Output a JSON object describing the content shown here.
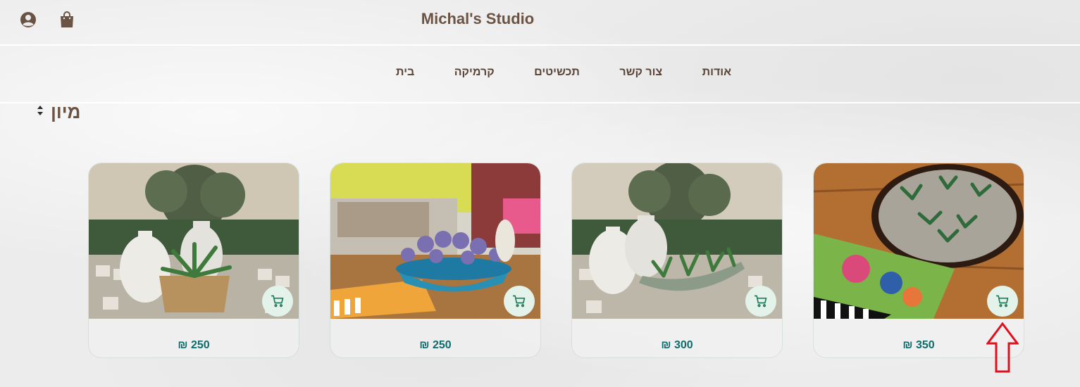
{
  "header": {
    "brand": "Michal's Studio",
    "icons": [
      "account-icon",
      "shopping-bag-icon"
    ]
  },
  "nav": {
    "items": [
      {
        "label": "בית"
      },
      {
        "label": "קרמיקה"
      },
      {
        "label": "תכשיטים"
      },
      {
        "label": "צור קשר"
      },
      {
        "label": "אודות"
      }
    ]
  },
  "sort": {
    "label": "מיון",
    "icon": "sort-icon"
  },
  "products": [
    {
      "price": "₪ 250",
      "image": "vases-succulent-pot"
    },
    {
      "price": "₪ 250",
      "image": "lavender-bowl"
    },
    {
      "price": "₪ 300",
      "image": "vases-succulent-boat"
    },
    {
      "price": "₪ 350",
      "image": "round-tray-succulents"
    }
  ],
  "colors": {
    "brand_text": "#6b5344",
    "price": "#0d6b6b",
    "cart_button_bg": "#e3f3ea",
    "arrow": "#e0101e"
  }
}
